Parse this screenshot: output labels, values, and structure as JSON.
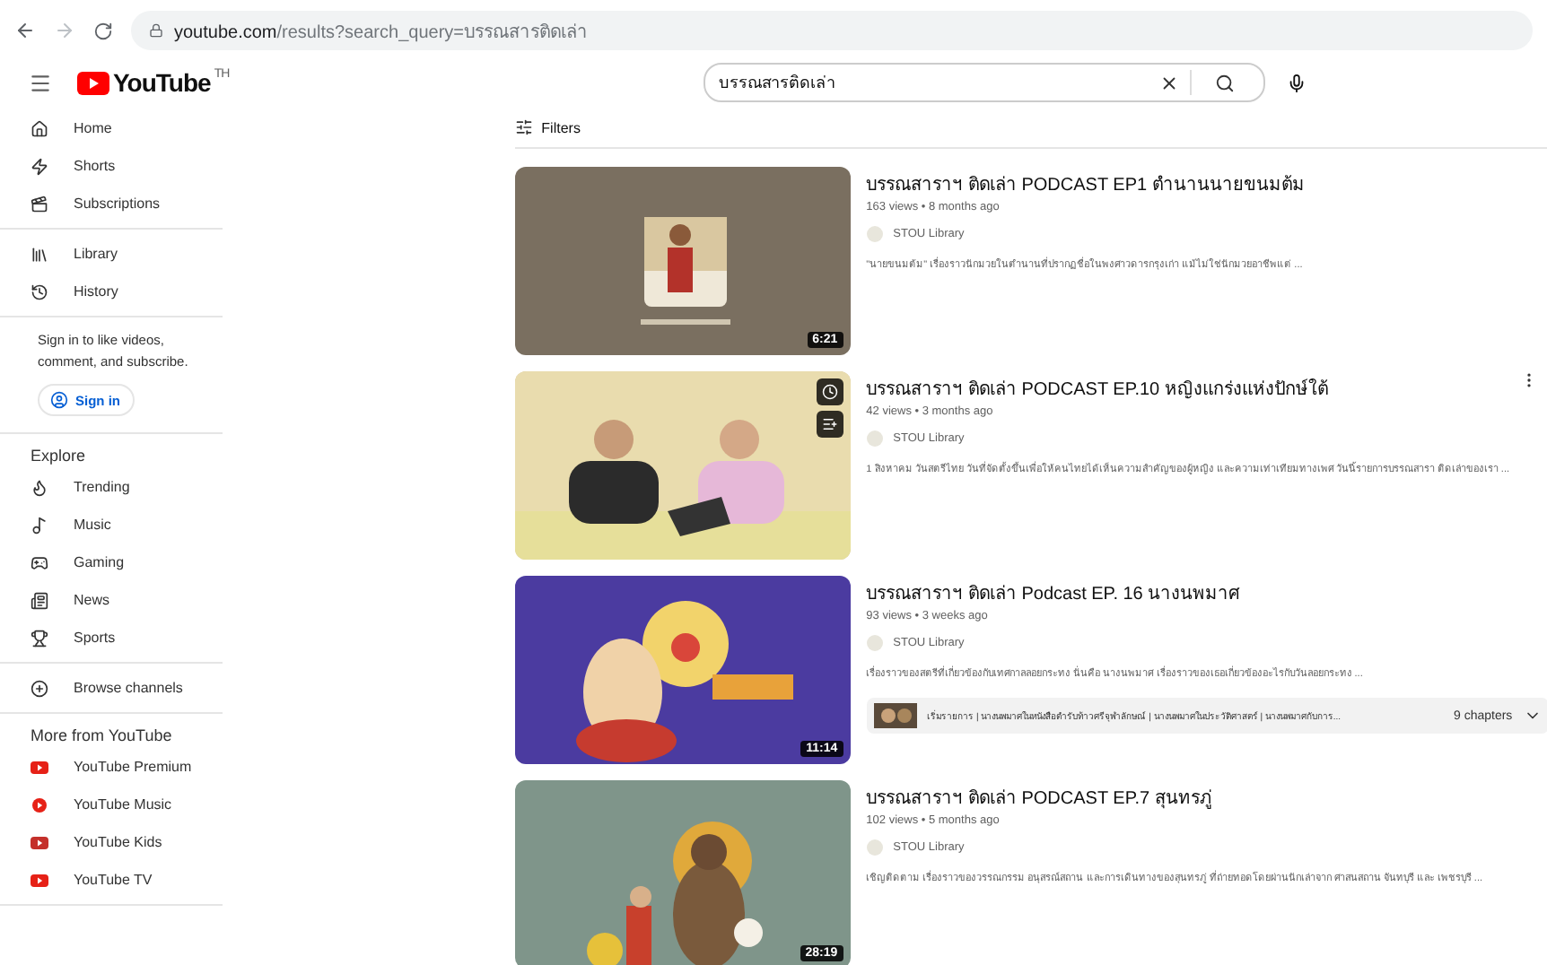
{
  "browser": {
    "url_host": "youtube.com",
    "url_path": "/results?search_query=บรรณสารติดเล่า"
  },
  "header": {
    "logo": "YouTube",
    "logo_mark": "TH",
    "search": {
      "value": "บรรณสารติดเล่า"
    }
  },
  "sidebar": {
    "sections": [
      {
        "items": [
          {
            "label": "Home",
            "selected": false
          },
          {
            "label": "Shorts",
            "selected": false
          },
          {
            "label": "Subscriptions",
            "selected": false
          }
        ]
      },
      {
        "items": [
          {
            "label": "Library",
            "selected": false
          },
          {
            "label": "History",
            "selected": false
          }
        ]
      },
      {
        "kind": "signin",
        "text": "Sign in to like videos, comment, and subscribe.",
        "button": "Sign in"
      },
      {
        "title": "Explore",
        "items": [
          {
            "label": "Trending",
            "selected": false
          },
          {
            "label": "Music",
            "selected": false
          },
          {
            "label": "Gaming",
            "selected": false
          },
          {
            "label": "News",
            "selected": false
          },
          {
            "label": "Sports",
            "selected": false
          }
        ]
      },
      {
        "items": [
          {
            "label": "Browse channels",
            "selected": false
          }
        ]
      },
      {
        "title": "More from YouTube",
        "items": [
          {
            "label": "YouTube Premium",
            "selected": false
          },
          {
            "label": "YouTube Music",
            "selected": false
          },
          {
            "label": "YouTube Kids",
            "selected": false
          },
          {
            "label": "YouTube TV",
            "selected": false
          }
        ]
      }
    ]
  },
  "filters": "Filters",
  "results": [
    {
      "title": "บรรณสาราฯ ติดเล่า PODCAST EP1 ตำนานนายขนมต้ม",
      "meta": "163 views • 8 months ago",
      "channel": "STOU Library",
      "description": "\"นายขนมต้ม\" เรื่องราวนักมวยในตำนานที่ปรากฏชื่อในพงศาวดารกรุงเก่า แม้ไม่ใช่นักมวยอาชีพแต่ ...",
      "duration": "6:21",
      "hover_controls": false
    },
    {
      "title": "บรรณสาราฯ ติดเล่า PODCAST EP.10 หญิงแกร่งแห่งปักษ์ใต้",
      "meta": "42 views • 3 months ago",
      "channel": "STOU Library",
      "description": "1 สิงหาคม วันสตรีไทย วันที่จัดตั้งขึ้นเพื่อให้คนไทยได้เห็นความสำคัญของผู้หญิง และความเท่าเทียมทางเพศ วันนี้รายการบรรณสารา ติดเล่าของเรา ...",
      "hover_controls": true
    },
    {
      "title": "บรรณสาราฯ ติดเล่า Podcast EP. 16 นางนพมาศ",
      "meta": "93 views • 3 weeks ago",
      "channel": "STOU Library",
      "description": "เรื่องราวของสตรีที่เกี่ยวข้องกับเทศกาลลอยกระทง นั่นคือ นางนพมาศ เรื่องราวของเธอเกี่ยวข้องอะไรกับวันลอยกระทง ...",
      "duration": "11:14",
      "hover_controls": false,
      "chapters": {
        "text": "เริ่มรายการ | นางนพมาศในหนังสือตำรับท้าวศรีจุฬาลักษณ์ | นางนพมาศในประวัติศาสตร์ | นางนพมาศกับการ...",
        "count": "9 chapters"
      }
    },
    {
      "title": "บรรณสาราฯ ติดเล่า PODCAST EP.7 สุนทรภู่",
      "meta": "102 views • 5 months ago",
      "channel": "STOU Library",
      "description": "เชิญติดตาม เรื่องราวของวรรณกรรม อนุสรณ์สถาน และการเดินทางของสุนทรภู่ ที่ถ่ายทอดโดยผ่านนักเล่าจาก ศาสนสถาน จันทบุรี และ เพชรบุรี ...",
      "duration": "28:19",
      "hover_controls": false
    }
  ]
}
